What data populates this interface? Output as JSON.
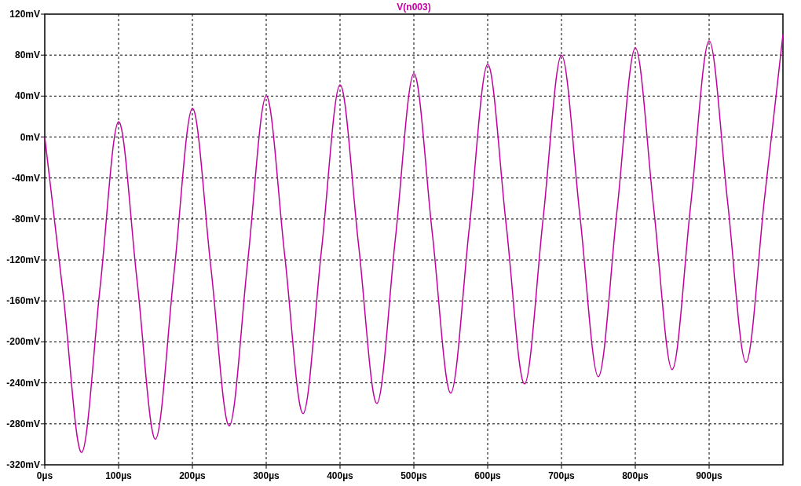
{
  "plot": {
    "chart_data": {
      "type": "line",
      "grid": true,
      "x": [
        0,
        25,
        50,
        75,
        100,
        125,
        150,
        175,
        200,
        225,
        250,
        275,
        300,
        325,
        350,
        375,
        400,
        425,
        450,
        475,
        500,
        525,
        550,
        575,
        600,
        625,
        650,
        675,
        700,
        725,
        750,
        775,
        800,
        825,
        850,
        875,
        900,
        925,
        950,
        975,
        1000
      ],
      "series": [
        {
          "name": "V(n003)",
          "color": "#c000a0",
          "values": [
            0,
            -154,
            -308,
            -146.5,
            15,
            -140,
            -295,
            -133.5,
            28,
            -127,
            -282,
            -121,
            40,
            -115,
            -270,
            -109.5,
            51,
            -104.5,
            -260,
            -99,
            62,
            -94,
            -250,
            -89.5,
            71,
            -85,
            -241,
            -80.5,
            80,
            -77,
            -234,
            -73.5,
            87,
            -70,
            -227,
            -66.5,
            94,
            -63,
            -220,
            -60,
            100
          ]
        }
      ],
      "xlim": [
        0,
        1000
      ],
      "ylim": [
        -320,
        120
      ],
      "xticks": [
        {
          "value": 0,
          "label": "0µs"
        },
        {
          "value": 100,
          "label": "100µs"
        },
        {
          "value": 200,
          "label": "200µs"
        },
        {
          "value": 300,
          "label": "300µs"
        },
        {
          "value": 400,
          "label": "400µs"
        },
        {
          "value": 500,
          "label": "500µs"
        },
        {
          "value": 600,
          "label": "600µs"
        },
        {
          "value": 700,
          "label": "700µs"
        },
        {
          "value": 800,
          "label": "800µs"
        },
        {
          "value": 900,
          "label": "900µs"
        }
      ],
      "yticks": [
        {
          "value": 120,
          "label": "120mV"
        },
        {
          "value": 80,
          "label": "80mV"
        },
        {
          "value": 40,
          "label": "40mV"
        },
        {
          "value": 0,
          "label": "0mV"
        },
        {
          "value": -40,
          "label": "-40mV"
        },
        {
          "value": -80,
          "label": "-80mV"
        },
        {
          "value": -120,
          "label": "-120mV"
        },
        {
          "value": -160,
          "label": "-160mV"
        },
        {
          "value": -200,
          "label": "-200mV"
        },
        {
          "value": -240,
          "label": "-240mV"
        },
        {
          "value": -280,
          "label": "-280mV"
        },
        {
          "value": -320,
          "label": "-320mV"
        }
      ]
    }
  }
}
